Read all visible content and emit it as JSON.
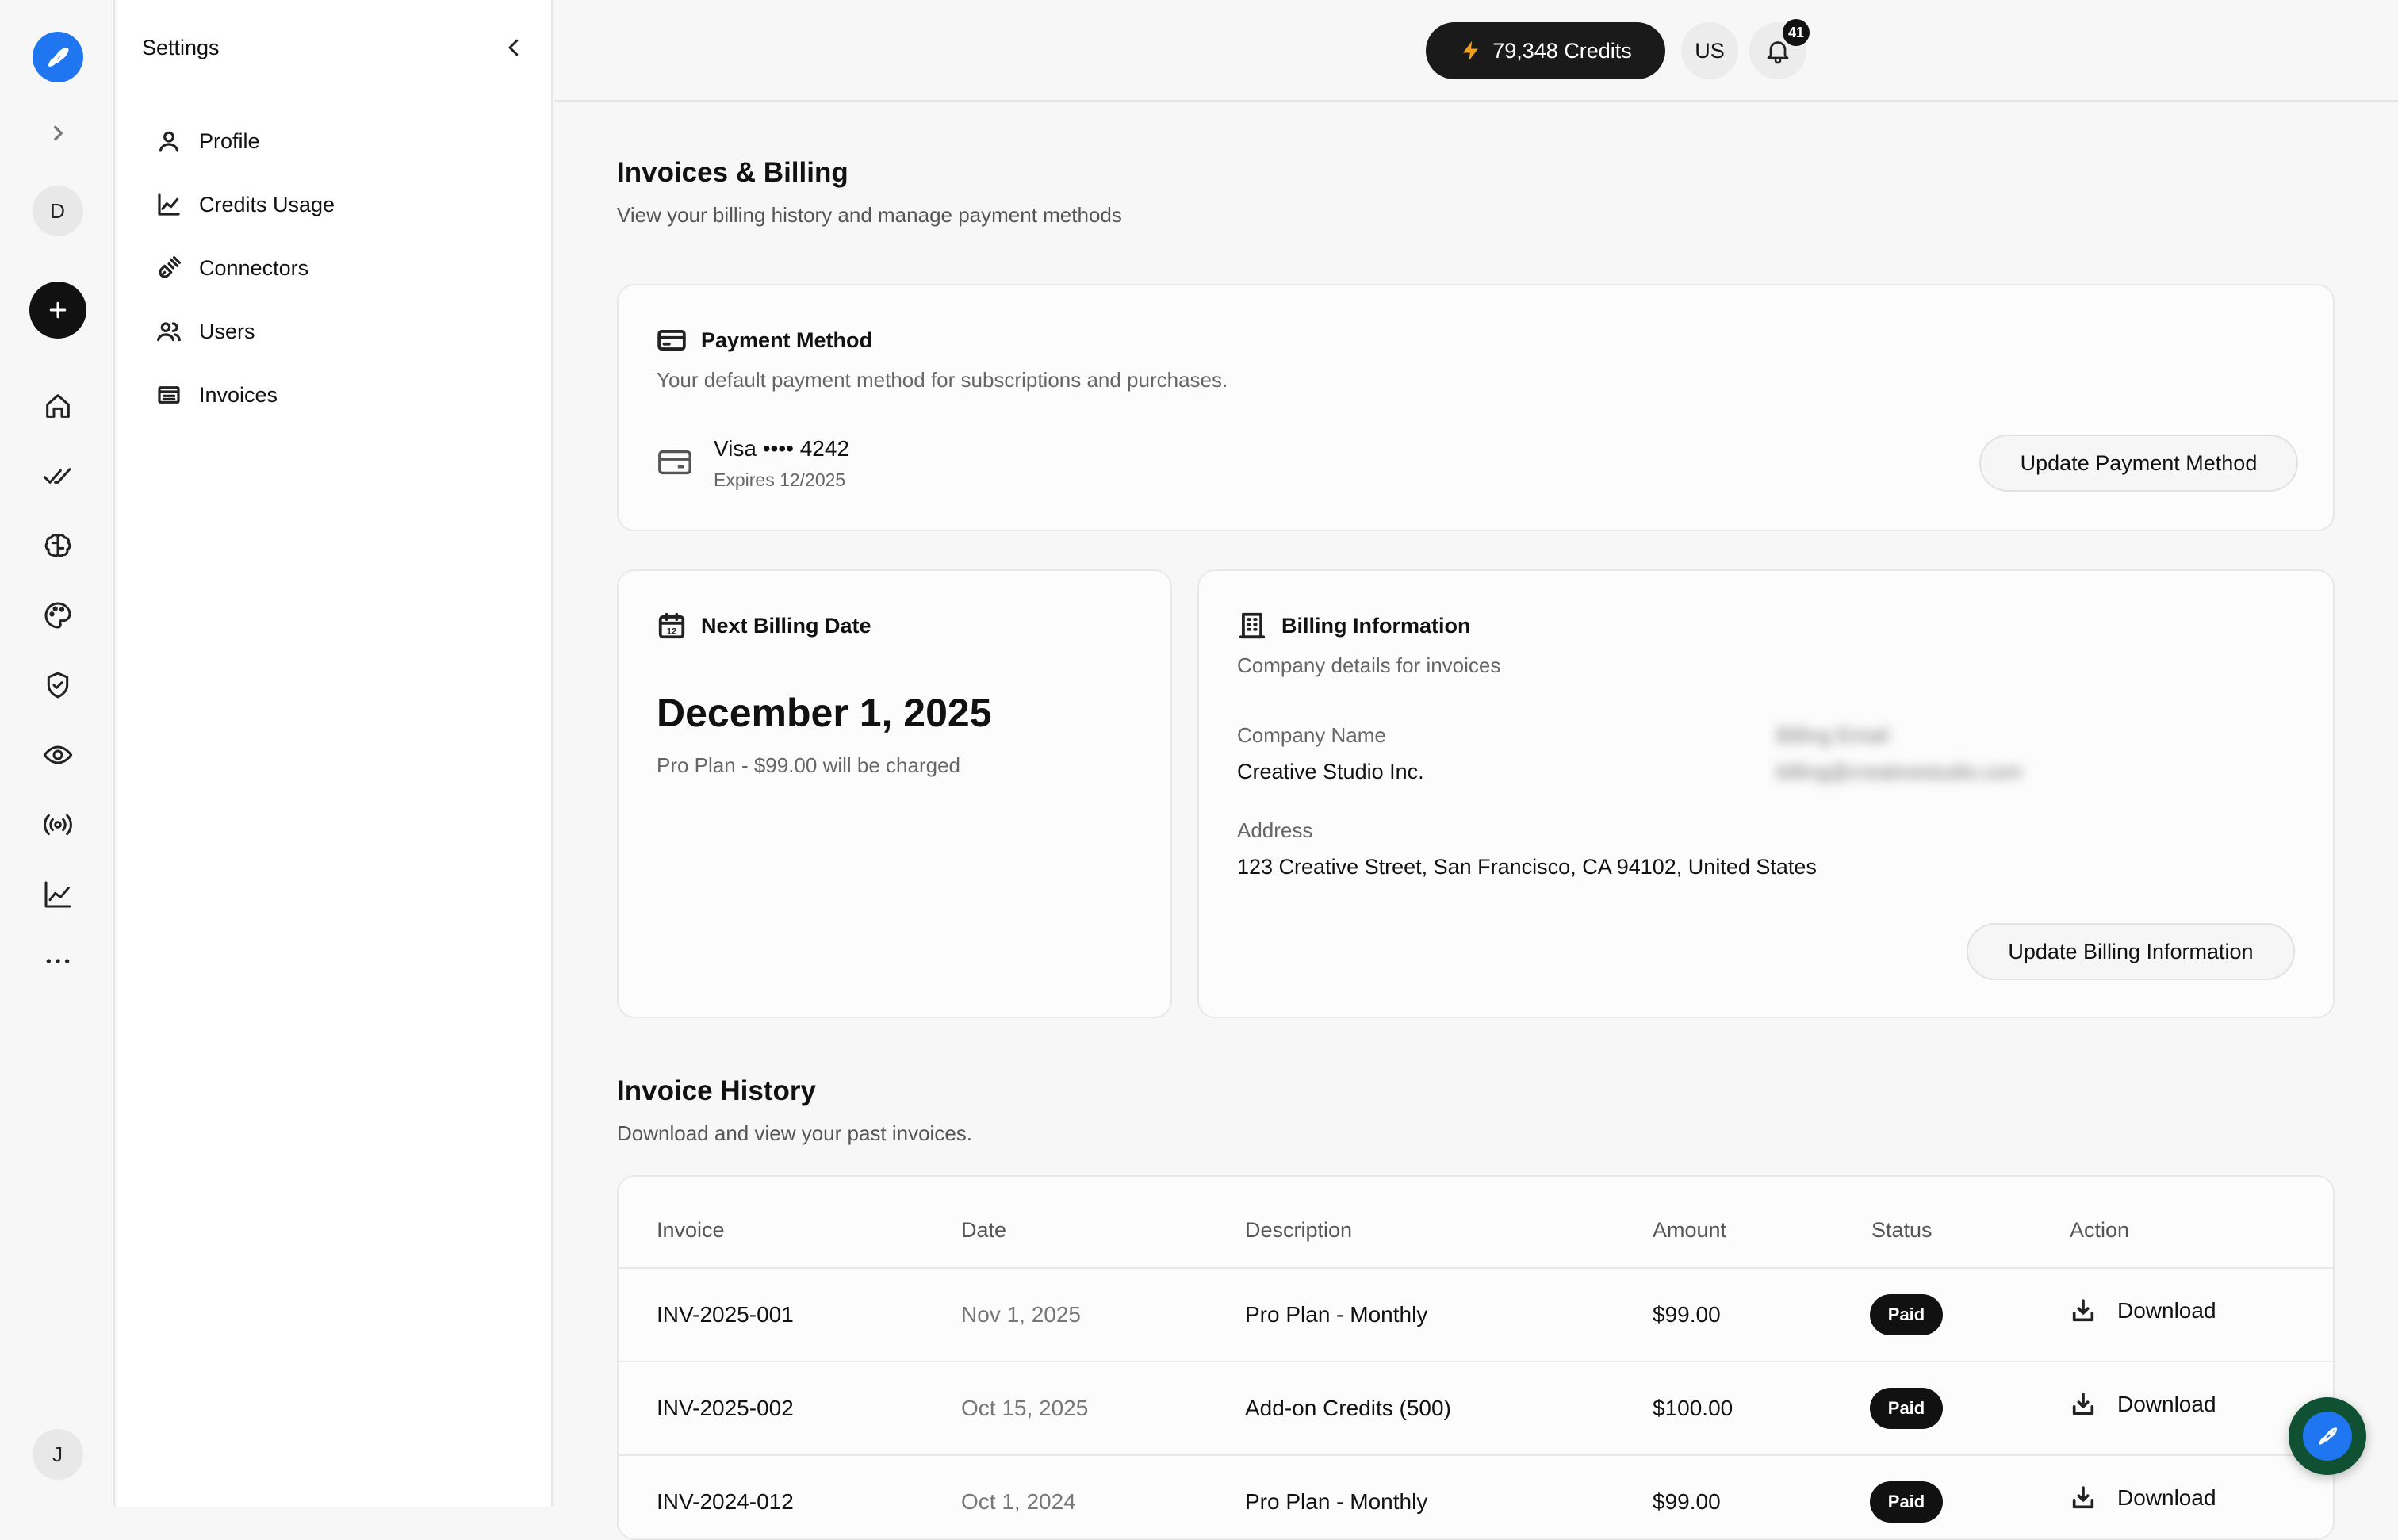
{
  "rail": {
    "collapsed_user": "D",
    "bottom_user": "J",
    "icons": [
      "rocket-logo-icon",
      "chevron-right-icon",
      "plus-icon",
      "home-icon",
      "double-check-icon",
      "brain-icon",
      "palette-icon",
      "shield-check-icon",
      "eye-icon",
      "broadcast-icon",
      "line-chart-icon",
      "more-icon"
    ]
  },
  "subnav": {
    "title": "Settings",
    "items": [
      {
        "label": "Profile",
        "icon": "user-icon"
      },
      {
        "label": "Credits Usage",
        "icon": "chart-icon"
      },
      {
        "label": "Connectors",
        "icon": "plug-icon"
      },
      {
        "label": "Users",
        "icon": "users-icon"
      },
      {
        "label": "Invoices",
        "icon": "invoice-icon"
      }
    ]
  },
  "topbar": {
    "credits": "79,348 Credits",
    "user_initials": "US",
    "notifications": "41"
  },
  "page": {
    "title": "Invoices & Billing",
    "subtitle": "View your billing history and manage payment methods"
  },
  "payment": {
    "title": "Payment Method",
    "subtitle": "Your default payment method for subscriptions and purchases.",
    "card_label": "Visa •••• 4242",
    "expires": "Expires 12/2025",
    "button": "Update Payment Method"
  },
  "next_billing": {
    "title": "Next Billing Date",
    "date": "December 1, 2025",
    "note": "Pro Plan - $99.00 will be charged"
  },
  "billing_info": {
    "title": "Billing Information",
    "subtitle": "Company details for invoices",
    "company_label": "Company Name",
    "company_value": "Creative Studio Inc.",
    "billing_email_label": "Billing Email",
    "billing_email_value": "billing@creativestudio.com",
    "address_label": "Address",
    "address_value": "123 Creative Street, San Francisco, CA 94102, United States",
    "button": "Update Billing Information"
  },
  "history": {
    "title": "Invoice History",
    "subtitle": "Download and view your past invoices.",
    "columns": [
      "Invoice",
      "Date",
      "Description",
      "Amount",
      "Status",
      "Action"
    ],
    "rows": [
      {
        "invoice": "INV-2025-001",
        "date": "Nov 1, 2025",
        "description": "Pro Plan - Monthly",
        "amount": "$99.00",
        "status": "Paid",
        "action": "Download"
      },
      {
        "invoice": "INV-2025-002",
        "date": "Oct 15, 2025",
        "description": "Add-on Credits (500)",
        "amount": "$100.00",
        "status": "Paid",
        "action": "Download"
      },
      {
        "invoice": "INV-2024-012",
        "date": "Oct 1, 2024",
        "description": "Pro Plan - Monthly",
        "amount": "$99.00",
        "status": "Paid",
        "action": "Download"
      }
    ]
  },
  "colors": {
    "accent_blue": "#1f76f0",
    "fab_ring": "#0f5132",
    "dark": "#1a1a1a"
  }
}
